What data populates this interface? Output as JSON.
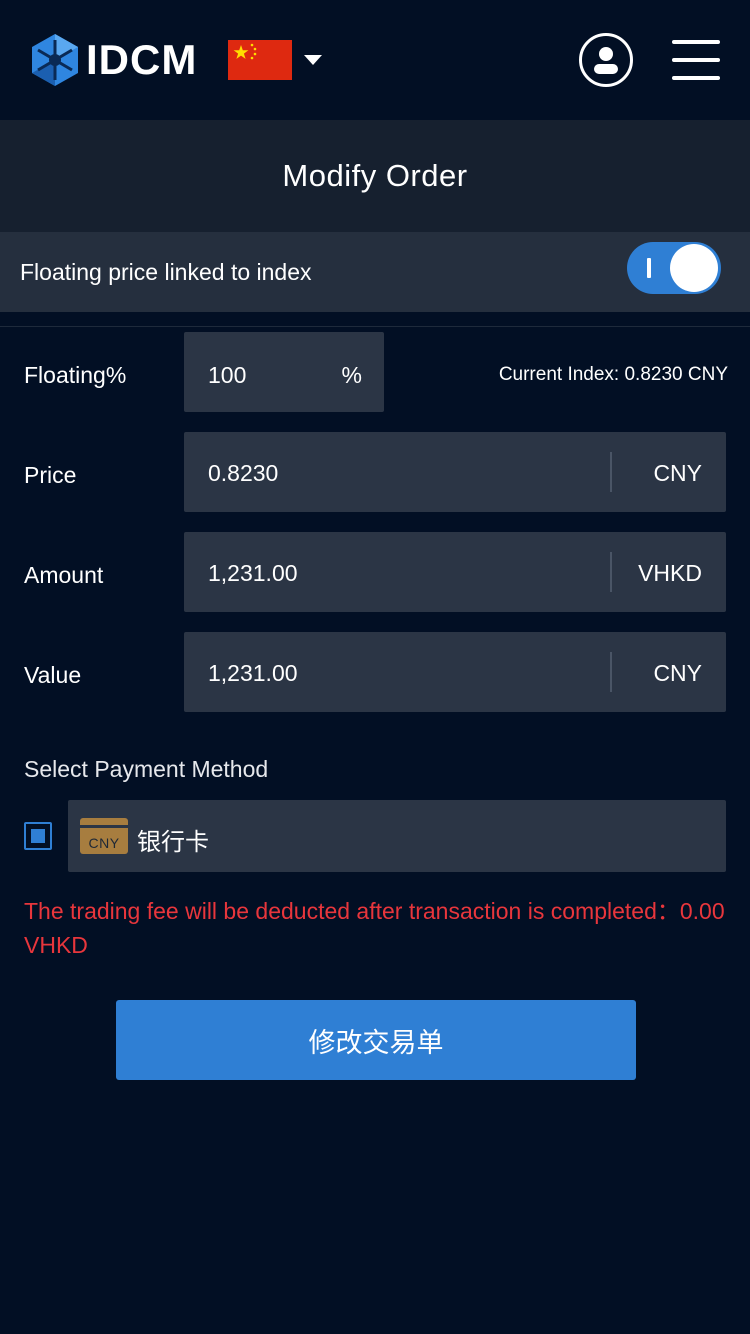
{
  "header": {
    "brand": "IDCM",
    "language_flag": "china-flag-icon",
    "icons": {
      "logo": "idcm-logo-icon",
      "caret": "caret-down-icon",
      "user": "user-account-icon",
      "menu": "hamburger-menu-icon"
    }
  },
  "page": {
    "title": "Modify Order"
  },
  "floating_toggle": {
    "label": "Floating price linked to index",
    "enabled": true
  },
  "form": {
    "floating": {
      "label": "Floating%",
      "value": "100",
      "unit": "%"
    },
    "current_index": "Current Index: 0.8230 CNY",
    "price": {
      "label": "Price",
      "value": "0.8230",
      "unit": "CNY"
    },
    "amount": {
      "label": "Amount",
      "value": "1,231.00",
      "unit": "VHKD"
    },
    "value": {
      "label": "Value",
      "value": "1,231.00",
      "unit": "CNY"
    }
  },
  "payment": {
    "section_label": "Select Payment Method",
    "method_currency": "CNY",
    "method_name": "银行卡",
    "selected": true
  },
  "fee_note": "The trading fee will be deducted after transaction is completed：0.00 VHKD",
  "submit_label": "修改交易单",
  "colors": {
    "accent": "#2f7fd4",
    "error": "#e8363c",
    "background": "#020f24",
    "field": "#2b3545"
  }
}
